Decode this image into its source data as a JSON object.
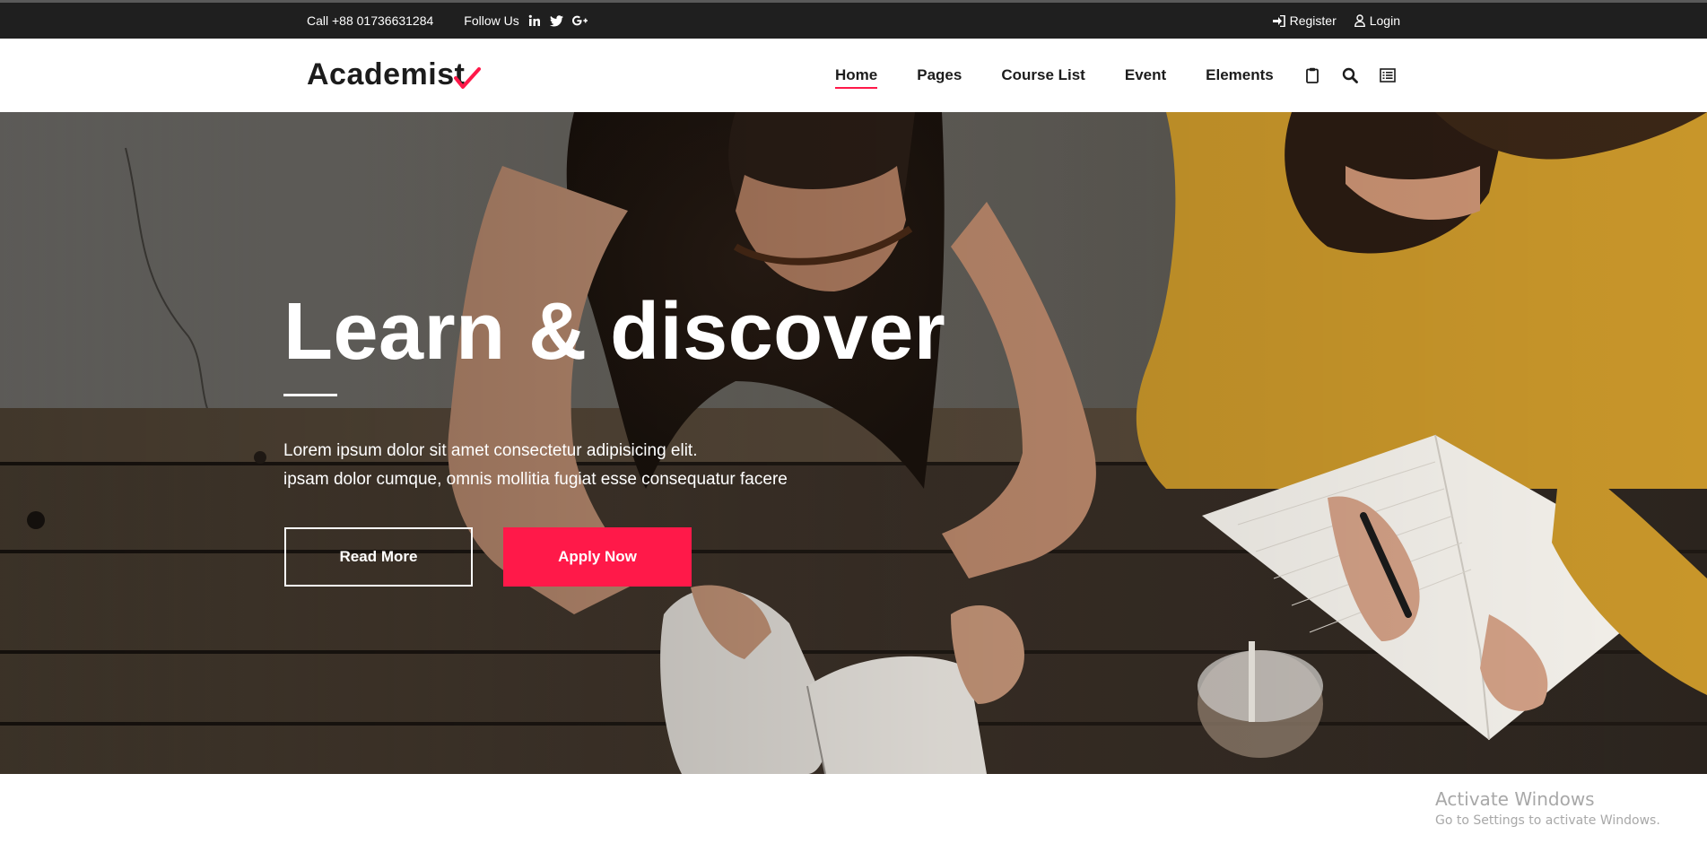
{
  "topbar": {
    "phone": "Call +88 01736631284",
    "follow_label": "Follow Us",
    "social": [
      {
        "icon": "linkedin-icon",
        "label": "in"
      },
      {
        "icon": "twitter-icon",
        "label": "twitter"
      },
      {
        "icon": "google-plus-icon",
        "label": "G+"
      }
    ],
    "register_label": "Register",
    "login_label": "Login"
  },
  "brand": {
    "logo_text": "Academist",
    "accent_color": "#ff1949"
  },
  "nav": {
    "items": [
      {
        "label": "Home",
        "active": true
      },
      {
        "label": "Pages",
        "active": false
      },
      {
        "label": "Course List",
        "active": false
      },
      {
        "label": "Event",
        "active": false
      },
      {
        "label": "Elements",
        "active": false
      }
    ],
    "icons": [
      "clipboard-icon",
      "search-icon",
      "menu-list-icon"
    ]
  },
  "hero": {
    "title": "Learn & discover",
    "description_line1": "Lorem ipsum dolor sit amet consectetur adipisicing elit.",
    "description_line2": "ipsam dolor cumque, omnis mollitia fugiat esse consequatur facere",
    "read_more_label": "Read More",
    "apply_now_label": "Apply Now"
  },
  "watermark": {
    "line1": "Activate Windows",
    "line2": "Go to Settings to activate Windows."
  }
}
